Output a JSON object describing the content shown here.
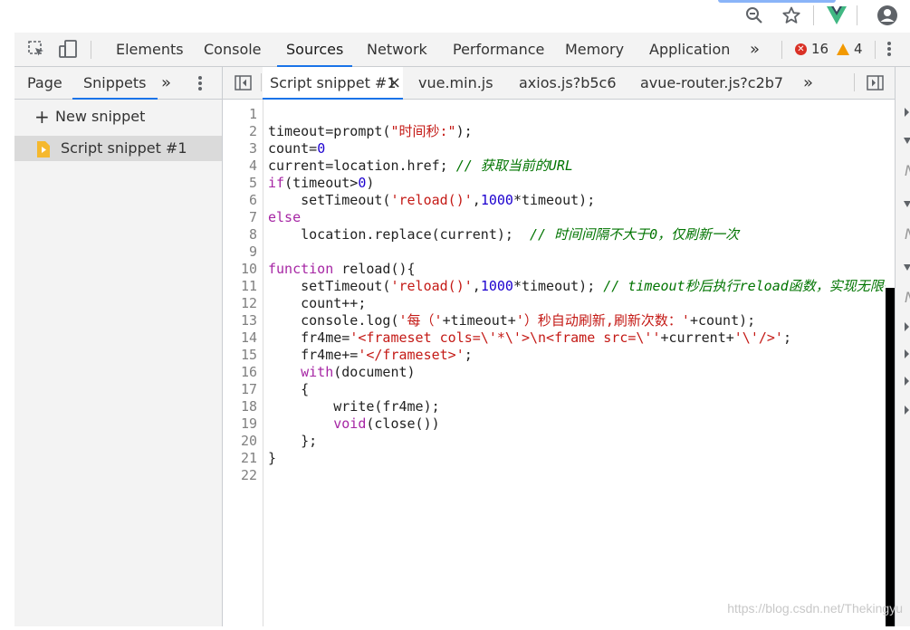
{
  "browser": {
    "icons": [
      "zoom-out-icon",
      "star-icon",
      "vue-devtools-icon",
      "account-icon"
    ]
  },
  "toolbar": {
    "tabs": [
      "Elements",
      "Console",
      "Sources",
      "Network",
      "Performance",
      "Memory",
      "Application"
    ],
    "active_tab": "Sources",
    "more": "»",
    "errors": "16",
    "warnings": "4"
  },
  "navigator": {
    "tabs": [
      "Page",
      "Snippets"
    ],
    "active_tab": "Snippets",
    "more": "»",
    "new_snippet": "New snippet",
    "snippet": "Script snippet #1"
  },
  "editor_tabs": {
    "active": "Script snippet #1",
    "close": "×",
    "others": [
      "vue.min.js",
      "axios.js?b5c6",
      "avue-router.js?c2b7"
    ],
    "more": "»"
  },
  "code": {
    "lines": [
      "",
      "timeout=prompt(\"时间秒:\");",
      "count=0",
      "current=location.href; // 获取当前的URL",
      "if(timeout>0)",
      "    setTimeout('reload()',1000*timeout);",
      "else",
      "    location.replace(current);  // 时间间隔不大于0，仅刷新一次",
      "",
      "function reload(){",
      "    setTimeout('reload()',1000*timeout); // timeout秒后执行reload函数，实现无限循环刷新",
      "    count++;",
      "    console.log('每（'+timeout+'）秒自动刷新,刷新次数：'+count);",
      "    fr4me='<frameset cols=\\'*\\'>\\n<frame src=\\''+current+'\\'/>';",
      "    fr4me+='</frameset>';",
      "    with(document)",
      "    {",
      "        write(fr4me);",
      "        void(close())",
      "    };",
      "}",
      ""
    ]
  },
  "watermark": "https://blog.csdn.net/Thekingyu"
}
